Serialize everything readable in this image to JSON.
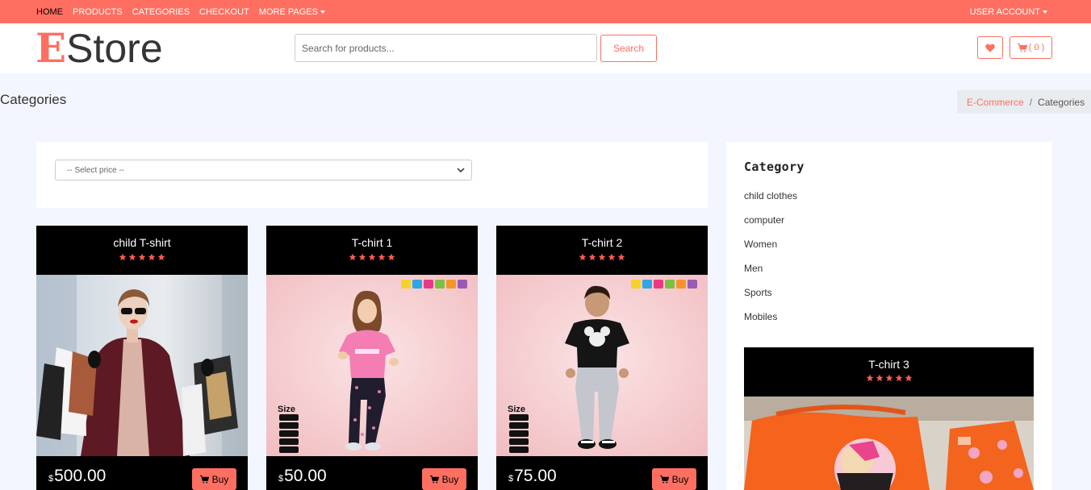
{
  "topnav": {
    "items": [
      {
        "label": "HOME"
      },
      {
        "label": "PRODUCTS"
      },
      {
        "label": "CATEGORIES"
      },
      {
        "label": "CHECKOUT"
      },
      {
        "label": "MORE PAGES"
      }
    ],
    "user_account": "USER ACCOUNT"
  },
  "header": {
    "logo_initial": "E",
    "logo_rest": "Store",
    "search_placeholder": "Search for products...",
    "search_label": "Search",
    "cart_label": "( 0 )"
  },
  "page": {
    "title": "Categories",
    "breadcrumb": {
      "home": "E-Commerce",
      "separator": "/",
      "current": "Categories"
    }
  },
  "filter": {
    "price_select": "-- Select price --"
  },
  "products": [
    {
      "title": "child T-shirt",
      "currency": "$",
      "price": "500.00",
      "buy_label": "Buy",
      "rating": 5
    },
    {
      "title": "T-chirt 1",
      "currency": "$",
      "price": "50.00",
      "buy_label": "Buy",
      "rating": 5
    },
    {
      "title": "T-chirt 2",
      "currency": "$",
      "price": "75.00",
      "buy_label": "Buy",
      "rating": 5
    }
  ],
  "sidebar": {
    "title": "Category",
    "categories": [
      "child clothes",
      "computer",
      "Women",
      "Men",
      "Sports",
      "Mobiles"
    ],
    "featured": {
      "title": "T-chirt 3",
      "rating": 5
    }
  },
  "colors": {
    "accent": "#ff6f61",
    "background": "#f3f6fe",
    "card_dark": "#000000"
  }
}
